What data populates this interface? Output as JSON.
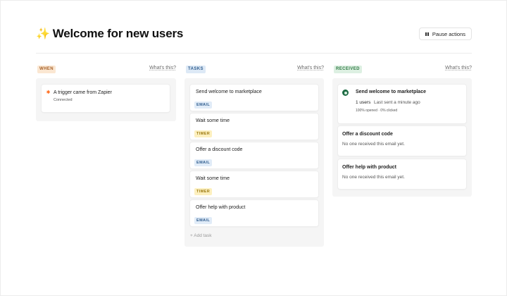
{
  "header": {
    "title": "Welcome for new users",
    "title_icon": "sparkles-icon",
    "pause_label": "Pause actions"
  },
  "columns": {
    "when": {
      "tag": "WHEN",
      "whats_this": "What's this?",
      "trigger": {
        "title": "A trigger came from Zapier",
        "status": "Connected",
        "icon": "zapier-icon"
      }
    },
    "tasks": {
      "tag": "TASKS",
      "whats_this": "What's this?",
      "items": [
        {
          "title": "Send welcome to marketplace",
          "badge": "EMAIL"
        },
        {
          "title": "Wait some time",
          "badge": "TIMER"
        },
        {
          "title": "Offer a discount code",
          "badge": "EMAIL"
        },
        {
          "title": "Wait some time",
          "badge": "TIMER"
        },
        {
          "title": "Offer help with product",
          "badge": "EMAIL"
        }
      ],
      "add_task": "+ Add task"
    },
    "received": {
      "tag": "RECEIVED",
      "whats_this": "What's this?",
      "primary": {
        "title": "Send welcome to marketplace",
        "users": "1 users",
        "last_sent": "Last sent a minute ago",
        "stats": "100% opened · 0% clicked"
      },
      "items": [
        {
          "title": "Offer a discount code",
          "subtitle": "No one received this email yet."
        },
        {
          "title": "Offer help with product",
          "subtitle": "No one received this email yet."
        }
      ]
    }
  },
  "colors": {
    "when_tag_bg": "#fbe7d2",
    "tasks_tag_bg": "#dde9f6",
    "received_tag_bg": "#ddf0e2",
    "email_badge_bg": "#e1ecf8",
    "timer_badge_bg": "#fdf0bf",
    "avatar": "#1e6b44"
  }
}
